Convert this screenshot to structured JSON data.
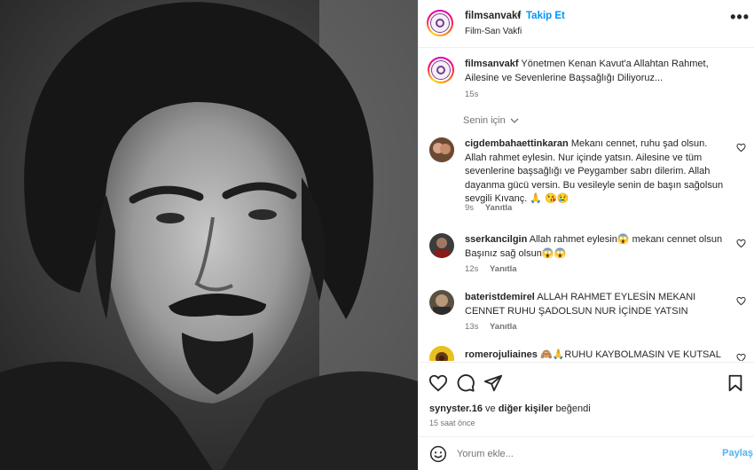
{
  "post": {
    "photo_alt": "",
    "header": {
      "username": "filmsanvakf",
      "separator": "•",
      "follow_label": "Takip Et",
      "subtitle": "Film-San Vakfi",
      "more_icon": "more-horizontal-icon",
      "more_label": "•••"
    },
    "caption": {
      "username": "filmsanvakf",
      "text": "Yönetmen Kenan Kavut'a Allahtan Rahmet, Ailesine ve Sevenlerine Başsağlığı Diliyoruz...",
      "time": "15s"
    },
    "filter": {
      "label": "Senin için",
      "icon": "chevron-down-icon"
    },
    "comments": [
      {
        "username": "cigdembahaettinkaran",
        "text": "Mekanı cennet, ruhu şad olsun. Allah rahmet eylesin. Nur içinde yatsın. Ailesine ve tüm sevenlerine başsağlığı ve Peygamber sabrı dilerim. Allah dayanma gücü versin. Bu vesileyle senin de başın sağolsun sevgili Kıvanç. 🙏 😘😢",
        "time": "9s",
        "reply": "Yanıtla"
      },
      {
        "username": "sserkancilgin",
        "text": "Allah rahmet eylesin😱 mekanı cennet olsun Başınız sağ olsun😱😱",
        "time": "12s",
        "reply": "Yanıtla"
      },
      {
        "username": "bateristdemirel",
        "text": "ALLAH RAHMET EYLESİN MEKANI CENNET RUHU ŞADOLSUN NUR İÇİNDE YATSIN",
        "time": "13s",
        "reply": "Yanıtla"
      },
      {
        "username": "romerojuliaines",
        "text": "🙈🙏RUHU KAYBOLMASIN VE KUTSAL",
        "time": "",
        "reply": ""
      }
    ],
    "actions": {
      "like_icon": "heart-icon",
      "comment_icon": "comment-icon",
      "share_icon": "send-icon",
      "save_icon": "bookmark-icon"
    },
    "likes": {
      "first_user": "synyster.16",
      "connector": "ve",
      "others": "diğer kişiler",
      "suffix": "beğendi"
    },
    "timestamp": "15 saat önce",
    "add_comment": {
      "placeholder": "Yorum ekle...",
      "post_label": "Paylaş",
      "emoji_icon": "smiley-icon"
    }
  },
  "colors": {
    "accent": "#0095f6",
    "text": "#262626",
    "muted": "#737373",
    "border": "#efefef"
  }
}
